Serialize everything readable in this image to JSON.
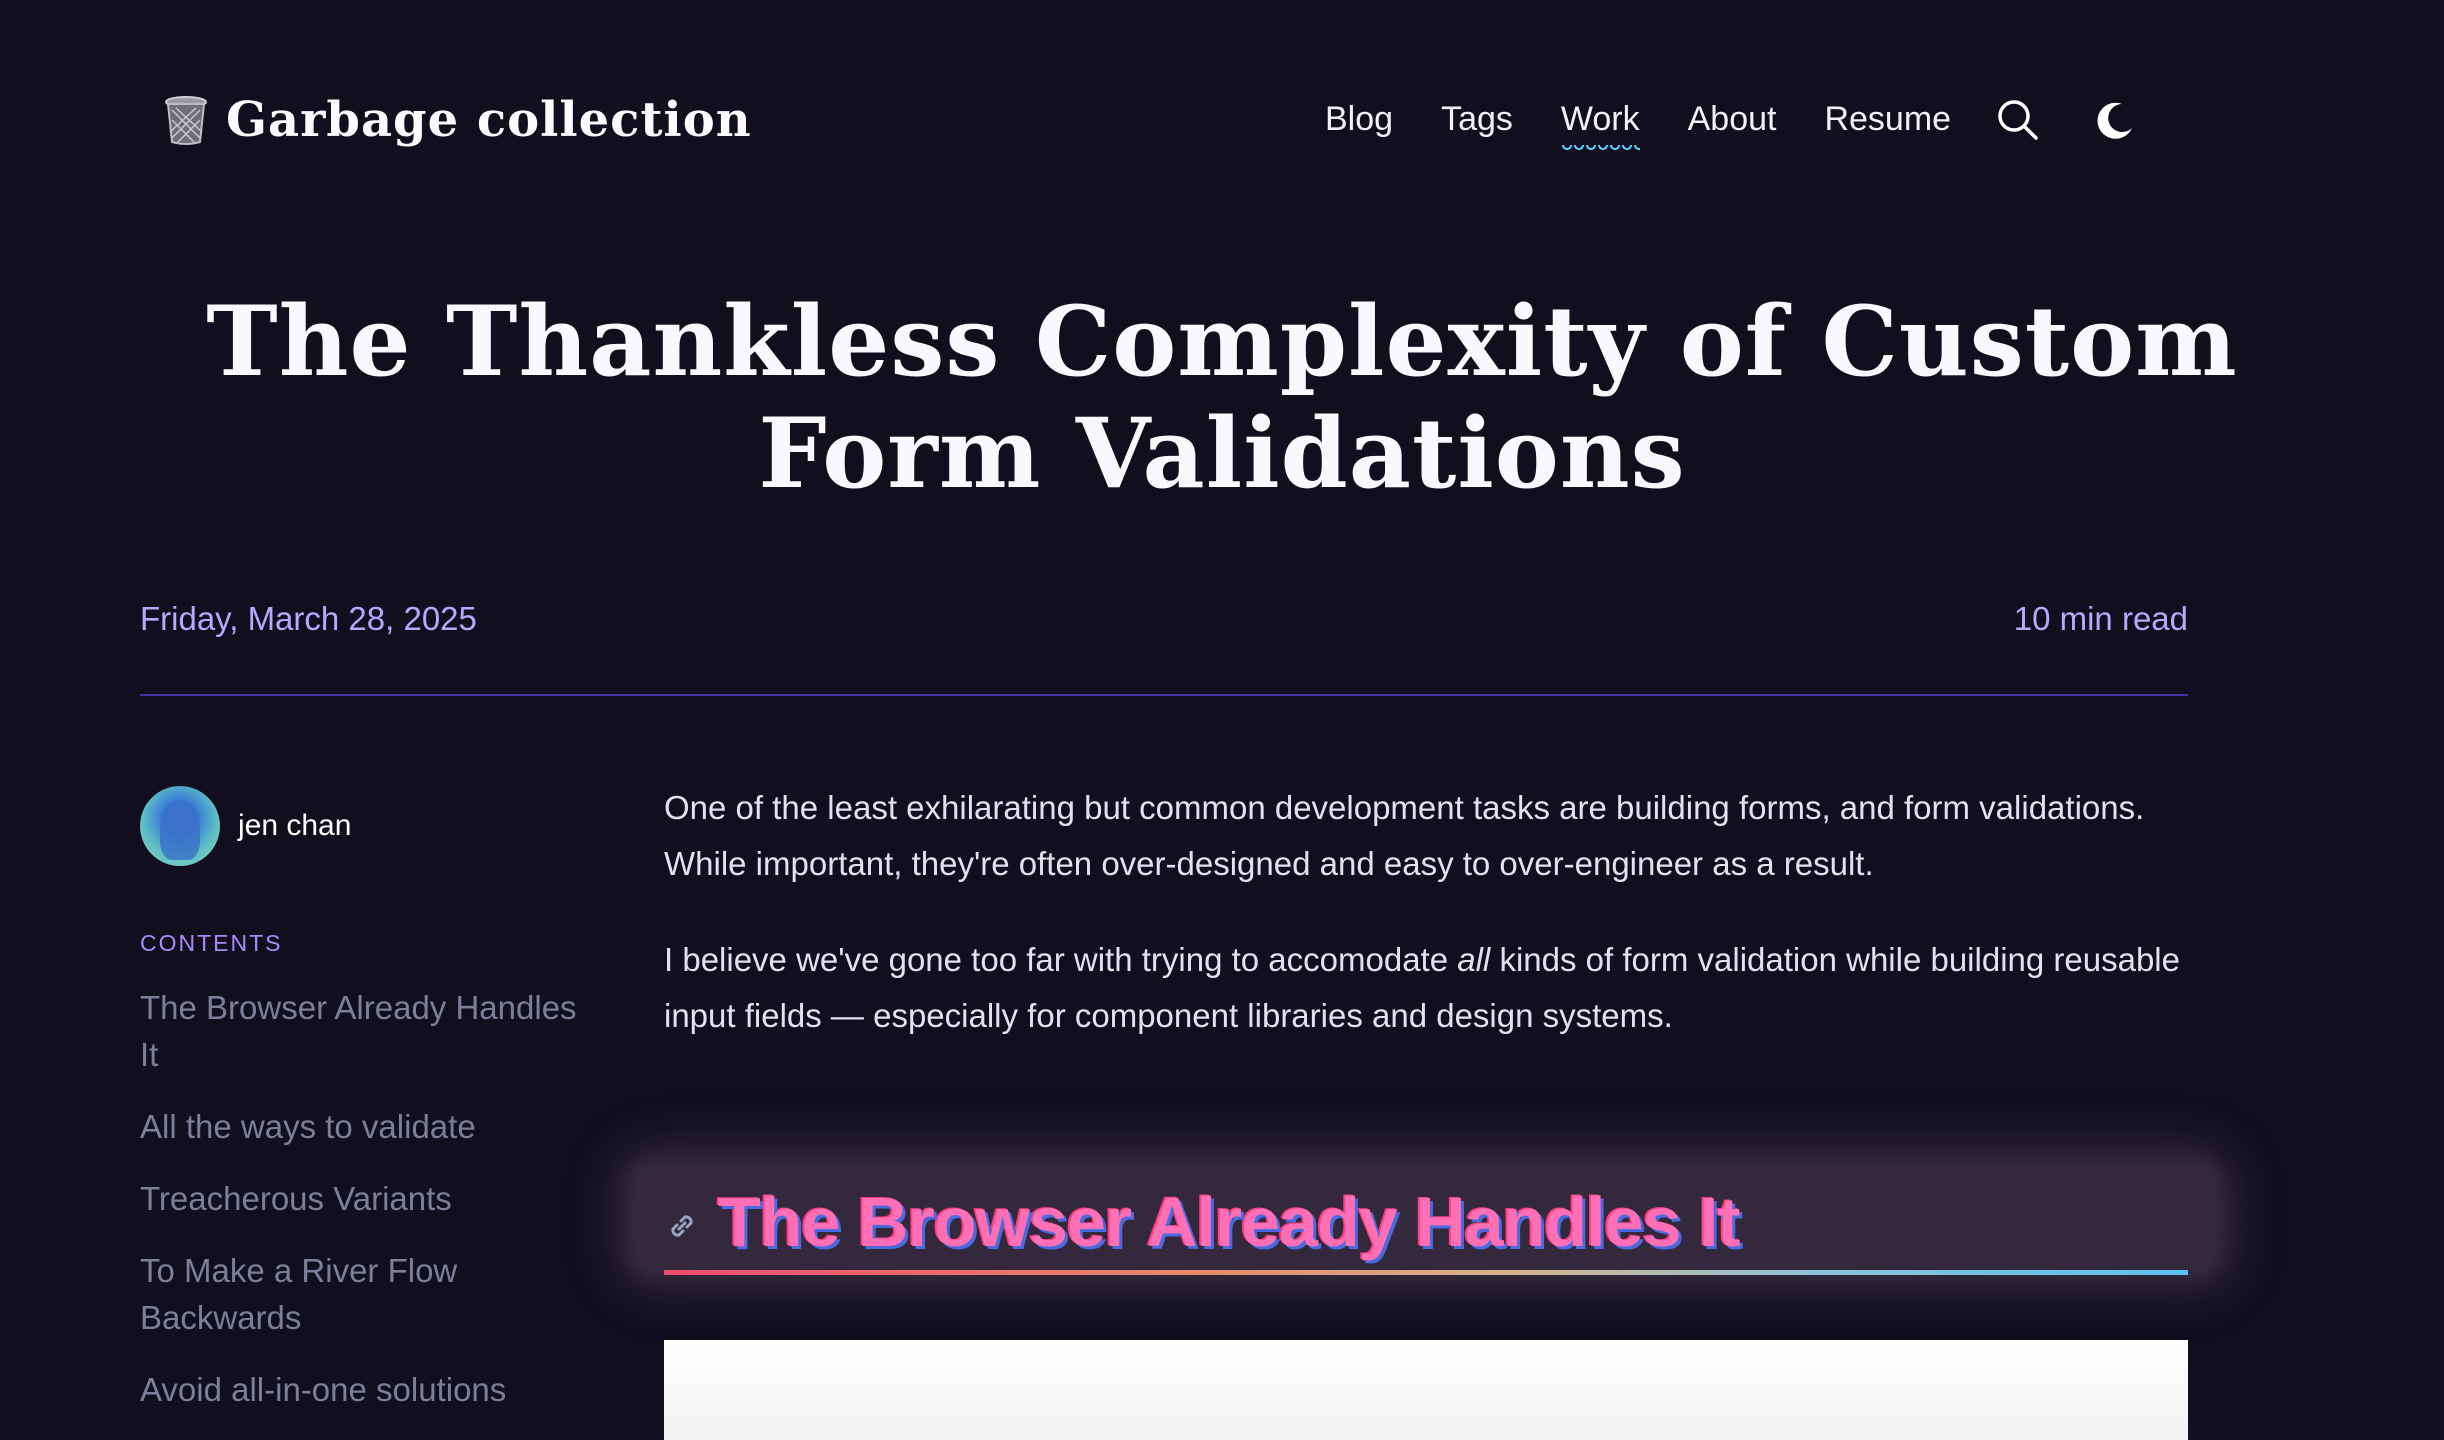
{
  "site": {
    "logo_emoji": "🗑",
    "title": "Garbage collection"
  },
  "nav": {
    "items": [
      {
        "label": "Blog"
      },
      {
        "label": "Tags"
      },
      {
        "label": "Work"
      },
      {
        "label": "About"
      },
      {
        "label": "Resume"
      }
    ],
    "active": "Work",
    "icons": [
      "search-icon",
      "moon-icon"
    ]
  },
  "post": {
    "title": "The Thankless Complexity of Custom Form Validations",
    "date": "Friday, March 28, 2025",
    "read_time": "10 min read"
  },
  "author": {
    "name": "jen chan"
  },
  "toc": {
    "heading": "CONTENTS",
    "items": [
      "The Browser Already Handles It",
      "All the ways to validate",
      "Treacherous Variants",
      "To Make a River Flow Backwards",
      "Avoid all-in-one solutions"
    ]
  },
  "article": {
    "p1": "One of the least exhilarating but common development tasks are building forms, and form validations. While important, they're often over-designed and easy to over-engineer as a result.",
    "p2_before": "I believe we've gone too far with trying to accomodate ",
    "p2_em": "all",
    "p2_after": " kinds of form validation while building reusable input fields — especially for component libraries and design systems.",
    "section_heading": "The Browser Already Handles It"
  },
  "colors": {
    "background": "#110f1e",
    "accent": "#b9a6ff",
    "divider": "#3f35a8",
    "nav_underline": "#4fd1ff"
  }
}
